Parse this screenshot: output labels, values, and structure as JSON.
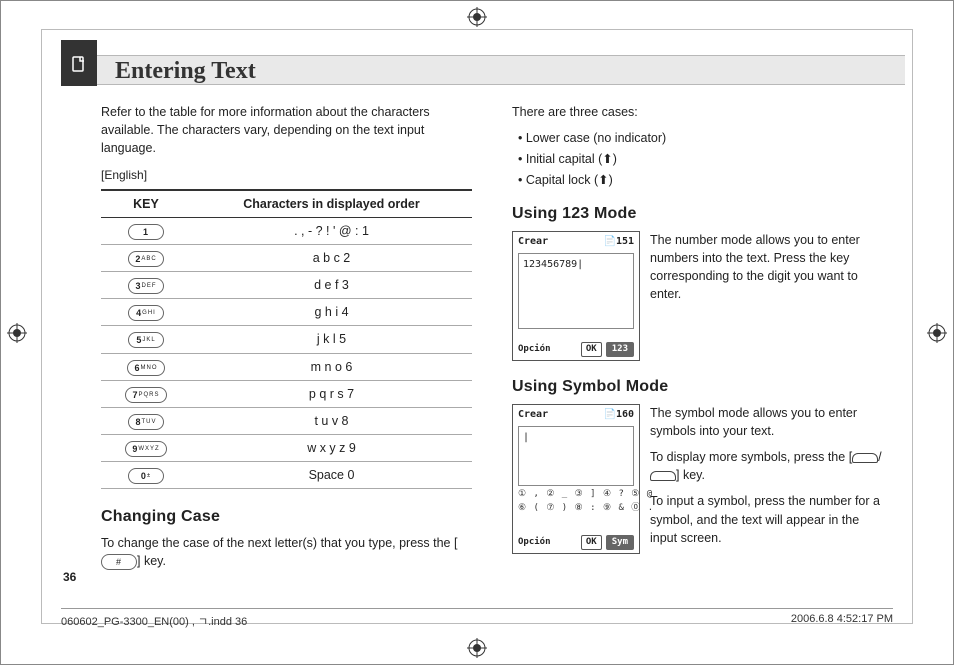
{
  "header": {
    "title": "Entering Text"
  },
  "left": {
    "intro": "Refer to the table for more information about the characters available. The characters vary, depending on the text input language.",
    "english_label": "[English]",
    "table": {
      "head_key": "KEY",
      "head_chars": "Characters in displayed order",
      "rows": [
        {
          "key": "1",
          "sub": "",
          "chars": ".  ,  -  ?  !  '  @ :  1"
        },
        {
          "key": "2",
          "sub": "ABC",
          "chars": "a  b  c  2"
        },
        {
          "key": "3",
          "sub": "DEF",
          "chars": "d  e  f  3"
        },
        {
          "key": "4",
          "sub": "GHI",
          "chars": "g  h  i  4"
        },
        {
          "key": "5",
          "sub": "JKL",
          "chars": "j  k  l  5"
        },
        {
          "key": "6",
          "sub": "MNO",
          "chars": "m  n  o  6"
        },
        {
          "key": "7",
          "sub": "PQRS",
          "chars": "p  q  r  s  7"
        },
        {
          "key": "8",
          "sub": "TUV",
          "chars": "t  u  v  8"
        },
        {
          "key": "9",
          "sub": "WXYZ",
          "chars": "w  x  y  z  9"
        },
        {
          "key": "0",
          "sub": "±",
          "chars": "Space  0"
        }
      ]
    },
    "changing_case_title": "Changing Case",
    "changing_case_body_a": "To change the case of the next letter(s) that you type, press the [",
    "changing_case_key": "#",
    "changing_case_body_b": "] key."
  },
  "right": {
    "cases_intro": "There are three cases:",
    "cases": [
      "Lower case (no indicator)",
      "Initial capital (⬆)",
      "Capital lock (⬆)"
    ],
    "mode123_title": "Using 123 Mode",
    "mode123_body": "The number mode allows you to enter numbers into the text. Press the key corresponding to the digit you want to enter.",
    "phone123": {
      "title": "Crear",
      "count": "151",
      "content": "123456789|",
      "left": "Opción",
      "ok": "OK",
      "badge": "123"
    },
    "modesym_title": "Using Symbol Mode",
    "modesym_p1": "The symbol mode allows you to enter symbols into your text.",
    "modesym_p2a": "To display more symbols, press the [",
    "modesym_p2b": "/",
    "modesym_p2c": "] key.",
    "modesym_p3": "To input a symbol, press the number for a symbol, and the text will appear in the input screen.",
    "phonesym": {
      "title": "Crear",
      "count": "160",
      "content": "|",
      "row1": "① , ② _ ③ ] ④ ? ⑤ @",
      "row2": "⑥ ( ⑦ ) ⑧ : ⑨ & ⓪ .",
      "left": "Opción",
      "ok": "OK",
      "badge": "Sym"
    }
  },
  "pagenum": "36",
  "footer": {
    "file": "060602_PG-3300_EN(00) , ㄱ.indd   36",
    "datetime": "2006.6.8   4:52:17 PM"
  }
}
